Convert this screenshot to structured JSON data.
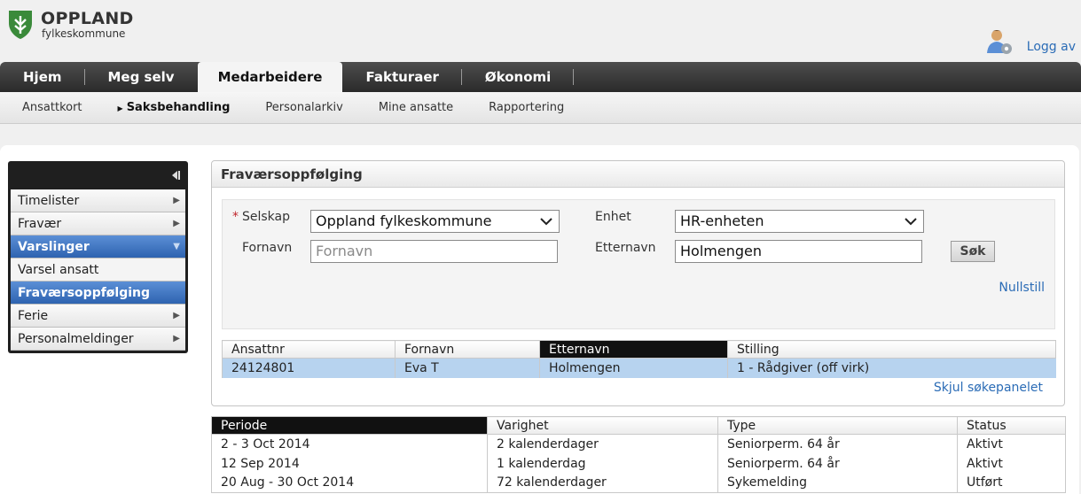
{
  "org": {
    "name": "OPPLAND",
    "sub": "fylkeskommune",
    "brand_color": "#3a8a3a"
  },
  "user": {
    "logout": "Logg av"
  },
  "topnav": [
    {
      "label": "Hjem"
    },
    {
      "label": "Meg selv"
    },
    {
      "label": "Medarbeidere",
      "active": true
    },
    {
      "label": "Fakturaer"
    },
    {
      "label": "Økonomi"
    }
  ],
  "subnav": [
    {
      "label": "Ansattkort"
    },
    {
      "label": "Saksbehandling",
      "active": true
    },
    {
      "label": "Personalarkiv"
    },
    {
      "label": "Mine ansatte"
    },
    {
      "label": "Rapportering"
    }
  ],
  "leftmenu": [
    {
      "label": "Timelister"
    },
    {
      "label": "Fravær"
    },
    {
      "label": "Varslinger",
      "expanded": true
    },
    {
      "label": "Varsel ansatt"
    },
    {
      "label": "Fraværsoppfølging",
      "selected": true
    },
    {
      "label": "Ferie"
    },
    {
      "label": "Personalmeldinger"
    }
  ],
  "panel": {
    "title": "Fraværsoppfølging",
    "company_label": "Selskap",
    "company_value": "Oppland fylkeskommune",
    "unit_label": "Enhet",
    "unit_value": "HR-enheten",
    "firstname_label": "Fornavn",
    "firstname_placeholder": "Fornavn",
    "lastname_label": "Etternavn",
    "lastname_value": "Holmengen",
    "search_button": "Søk",
    "reset_link": "Nullstill",
    "hide_link": "Skjul søkepanelet"
  },
  "result": {
    "columns": [
      "Ansattnr",
      "Fornavn",
      "Etternavn",
      "Stilling"
    ],
    "sorted_column": "Etternavn",
    "rows": [
      [
        "24124801",
        "Eva T",
        "Holmengen",
        "1 - Rådgiver (off virk)"
      ]
    ]
  },
  "absence": {
    "columns": [
      "Periode",
      "Varighet",
      "Type",
      "Status"
    ],
    "sorted_column": "Periode",
    "rows": [
      [
        "2 - 3 Oct 2014",
        "2 kalenderdager",
        "Seniorperm. 64 år",
        "Aktivt"
      ],
      [
        "12 Sep 2014",
        "1 kalenderdag",
        "Seniorperm. 64 år",
        "Aktivt"
      ],
      [
        "20 Aug - 30 Oct 2014",
        "72 kalenderdager",
        "Sykemelding",
        "Utført"
      ]
    ]
  }
}
